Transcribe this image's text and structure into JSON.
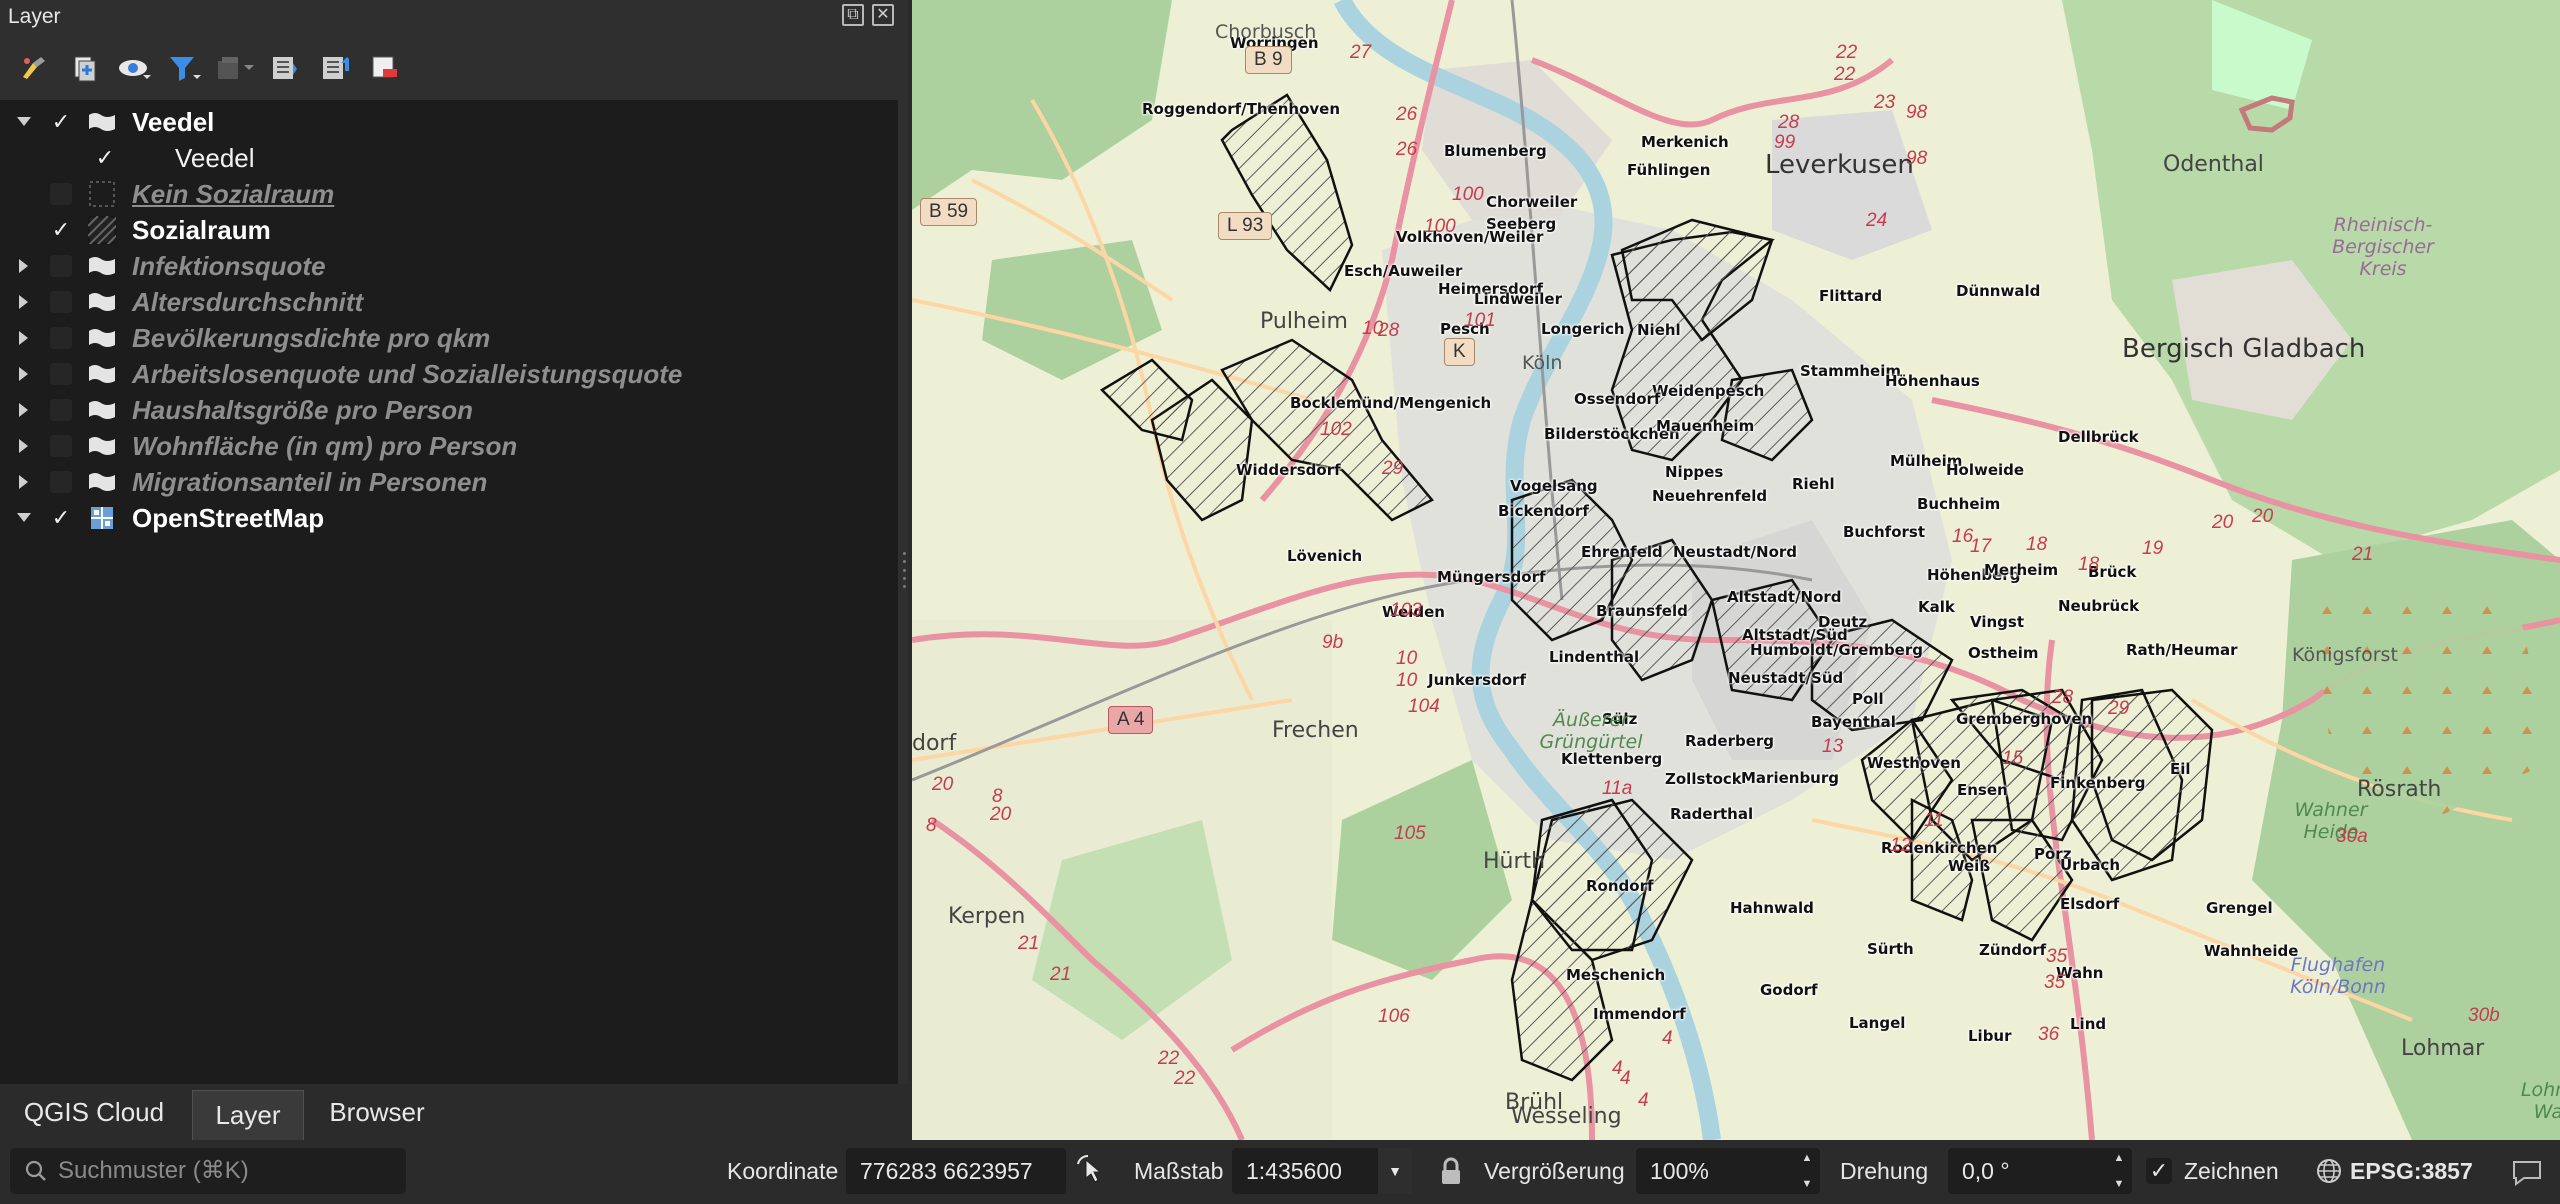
{
  "dock": {
    "title": "Layer",
    "float_glyph": "⧉",
    "close_glyph": "✕"
  },
  "toolbar_icons": [
    "paint-style-icon",
    "add-group-icon",
    "visibility-eye-icon",
    "filter-legend-icon",
    "filter-expression-icon",
    "expand-all-icon",
    "collapse-all-icon",
    "remove-layer-icon"
  ],
  "layers": [
    {
      "label": "Veedel",
      "checked": true,
      "expandable": true,
      "expanded": true,
      "style": "bold",
      "symbol": "group-icon"
    },
    {
      "label": "Veedel",
      "checked": true,
      "expandable": false,
      "style": "plain",
      "symbol": "none",
      "indent": 1
    },
    {
      "label": "Kein Sozialraum",
      "checked": false,
      "expandable": false,
      "style": "dim-ul",
      "symbol": "dotted-fill-icon"
    },
    {
      "label": "Sozialraum",
      "checked": true,
      "expandable": false,
      "style": "bold",
      "symbol": "hatched-fill-icon"
    },
    {
      "label": "Infektionsquote",
      "checked": false,
      "expandable": true,
      "expanded": false,
      "style": "dim",
      "symbol": "group-icon"
    },
    {
      "label": "Altersdurchschnitt",
      "checked": false,
      "expandable": true,
      "expanded": false,
      "style": "dim",
      "symbol": "group-icon"
    },
    {
      "label": "Bevölkerungsdichte pro qkm",
      "checked": false,
      "expandable": true,
      "expanded": false,
      "style": "dim",
      "symbol": "group-icon"
    },
    {
      "label": "Arbeitslosenquote und Sozialleistungsquote",
      "checked": false,
      "expandable": true,
      "expanded": false,
      "style": "dim",
      "symbol": "group-icon"
    },
    {
      "label": "Haushaltsgröße pro Person",
      "checked": false,
      "expandable": true,
      "expanded": false,
      "style": "dim",
      "symbol": "group-icon"
    },
    {
      "label": "Wohnfläche (in qm) pro Person",
      "checked": false,
      "expandable": true,
      "expanded": false,
      "style": "dim",
      "symbol": "group-icon"
    },
    {
      "label": "Migrationsanteil in Personen",
      "checked": false,
      "expandable": true,
      "expanded": false,
      "style": "dim",
      "symbol": "group-icon"
    },
    {
      "label": "OpenStreetMap",
      "checked": true,
      "expandable": true,
      "expanded": true,
      "style": "bold",
      "symbol": "raster-tile-icon"
    }
  ],
  "tabs": [
    {
      "label": "QGIS Cloud",
      "active": false
    },
    {
      "label": "Layer",
      "active": true
    },
    {
      "label": "Browser",
      "active": false
    }
  ],
  "map": {
    "colors": {
      "background": "#f2efe9",
      "forest": "#add19e",
      "park": "#c8facc",
      "water": "#aad3df",
      "motorway": "#e892a2",
      "primary": "#fcd6a4",
      "hatch": "#555555"
    },
    "cities": [
      {
        "text": "Leverkusen",
        "size": "big"
      },
      {
        "text": "Bergisch Gladbach",
        "size": "big"
      },
      {
        "text": "Pulheim",
        "size": "normal"
      },
      {
        "text": "Frechen",
        "size": "normal"
      },
      {
        "text": "Hürth",
        "size": "normal"
      },
      {
        "text": "Kerpen",
        "size": "normal"
      },
      {
        "text": "Brühl",
        "size": "normal"
      },
      {
        "text": "Odenthal",
        "size": "normal"
      },
      {
        "text": "Rösrath",
        "size": "normal"
      },
      {
        "text": "Lohmar",
        "size": "normal"
      },
      {
        "text": "Wesseling",
        "size": "normal"
      },
      {
        "text": "dorf",
        "size": "normal"
      },
      {
        "text": "Chorbusch",
        "size": "small"
      },
      {
        "text": "Rheinisch-Bergischer Kreis",
        "size": "small"
      },
      {
        "text": "Äußerer Grüngürtel",
        "size": "small"
      },
      {
        "text": "Wahner Heide",
        "size": "small"
      },
      {
        "text": "Flughafen Köln/Bonn",
        "size": "small"
      },
      {
        "text": "Königsforst",
        "size": "small"
      },
      {
        "text": "Köln",
        "size": "small"
      },
      {
        "text": "Lohmar Wald",
        "size": "small"
      }
    ],
    "shields": [
      "B 9",
      "B 59",
      "L 93",
      "A 4",
      "K"
    ],
    "route_numbers": [
      "27",
      "26",
      "26",
      "22",
      "22",
      "23",
      "98",
      "98",
      "99",
      "28",
      "24",
      "100",
      "100",
      "101",
      "10",
      "102",
      "28",
      "29",
      "16",
      "17",
      "18",
      "18",
      "19",
      "20",
      "20",
      "21",
      "9b",
      "103",
      "10",
      "10",
      "104",
      "105",
      "106",
      "22",
      "22",
      "21",
      "21",
      "20",
      "8",
      "20",
      "8",
      "11a",
      "12",
      "13",
      "11",
      "28",
      "29",
      "30a",
      "30b",
      "35",
      "35",
      "36",
      "4",
      "4",
      "4",
      "4",
      "15"
    ],
    "labels": [
      "Worringen",
      "Roggendorf/Thenhoven",
      "Blumenberg",
      "Merkenich",
      "Fühlingen",
      "Chorweiler",
      "Seeberg",
      "Volkhoven/Weiler",
      "Esch/Auweiler",
      "Heimersdorf",
      "Lindweiler",
      "Pesch",
      "Longerich",
      "Niehl",
      "Flittard",
      "Dünnwald",
      "Stammheim",
      "Höhenhaus",
      "Weidenpesch",
      "Ossendorf",
      "Bocklemünd/Mengenich",
      "Bilderstöckchen",
      "Mauenheim",
      "Dellbrück",
      "Widdersdorf",
      "Vogelsang",
      "Nippes",
      "Mülheim",
      "Holweide",
      "Riehl",
      "Bickendorf",
      "Neuehrenfeld",
      "Buchheim",
      "Buchforst",
      "Lövenich",
      "Ehrenfeld",
      "Neustadt/Nord",
      "Höhenberg",
      "Merheim",
      "Brück",
      "Müngersdorf",
      "Altstadt/Nord",
      "Kalk",
      "Vingst",
      "Neubrück",
      "Weiden",
      "Braunsfeld",
      "Deutz",
      "Altstadt/Süd",
      "Humboldt/Gremberg",
      "Ostheim",
      "Rath/Heumar",
      "Lindenthal",
      "Neustadt/Süd",
      "Junkersdorf",
      "Poll",
      "Gremberghoven",
      "Sülz",
      "Bayenthal",
      "Raderberg",
      "Klettenberg",
      "Westhoven",
      "Eil",
      "Zollstock",
      "Marienburg",
      "Ensen",
      "Finkenberg",
      "Raderthal",
      "Rodenkirchen",
      "Porz",
      "Rondorf",
      "Weiß",
      "Urbach",
      "Grengel",
      "Hahnwald",
      "Elsdorf",
      "Sürth",
      "Zündorf",
      "Wahnheide",
      "Meschenich",
      "Godorf",
      "Wahn",
      "Immendorf",
      "Langel",
      "Libur",
      "Lind"
    ]
  },
  "status": {
    "search_placeholder": "Suchmuster (⌘K)",
    "coord_label": "Koordinate",
    "coord_value": "776283 6623957",
    "scale_label": "Maßstab",
    "scale_value": "1:435600",
    "magnifier_label": "Vergrößerung",
    "magnifier_value": "100%",
    "rotation_label": "Drehung",
    "rotation_value": "0,0 °",
    "render_label": "Zeichnen",
    "render_checked": true,
    "crs_label": "EPSG:3857"
  }
}
